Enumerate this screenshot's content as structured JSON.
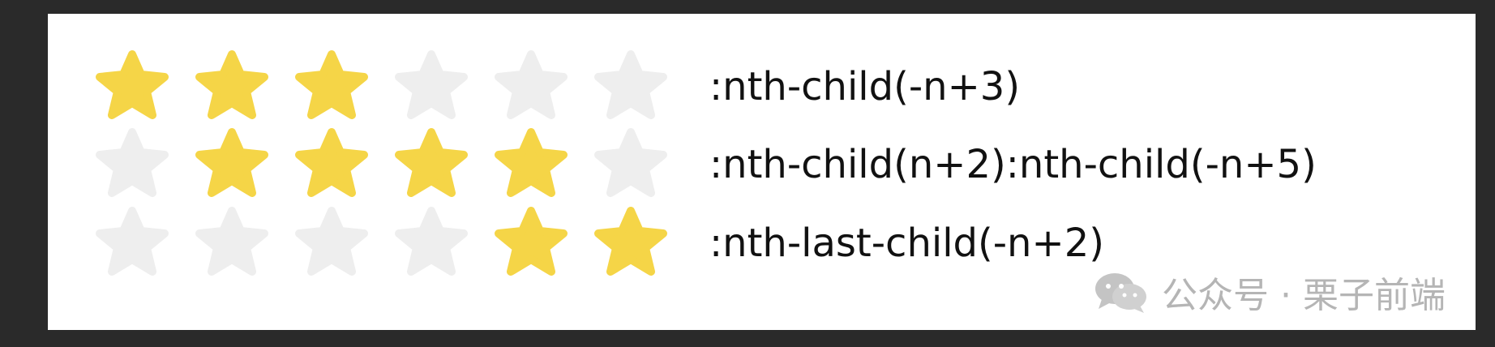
{
  "rows": [
    {
      "selector": ":nth-child(-n+3)",
      "stars": [
        true,
        true,
        true,
        false,
        false,
        false
      ]
    },
    {
      "selector": ":nth-child(n+2):nth-child(-n+5)",
      "stars": [
        false,
        true,
        true,
        true,
        true,
        false
      ]
    },
    {
      "selector": ":nth-last-child(-n+2)",
      "stars": [
        false,
        false,
        false,
        false,
        true,
        true
      ]
    }
  ],
  "watermark": {
    "icon": "wechat-icon",
    "text": "公众号 · 栗子前端"
  },
  "colors": {
    "star_on": "#f5d547",
    "star_off": "#eeeeee",
    "background": "#2a2a2a",
    "panel": "#ffffff",
    "text": "#111111",
    "watermark": "#b5b5b5"
  }
}
